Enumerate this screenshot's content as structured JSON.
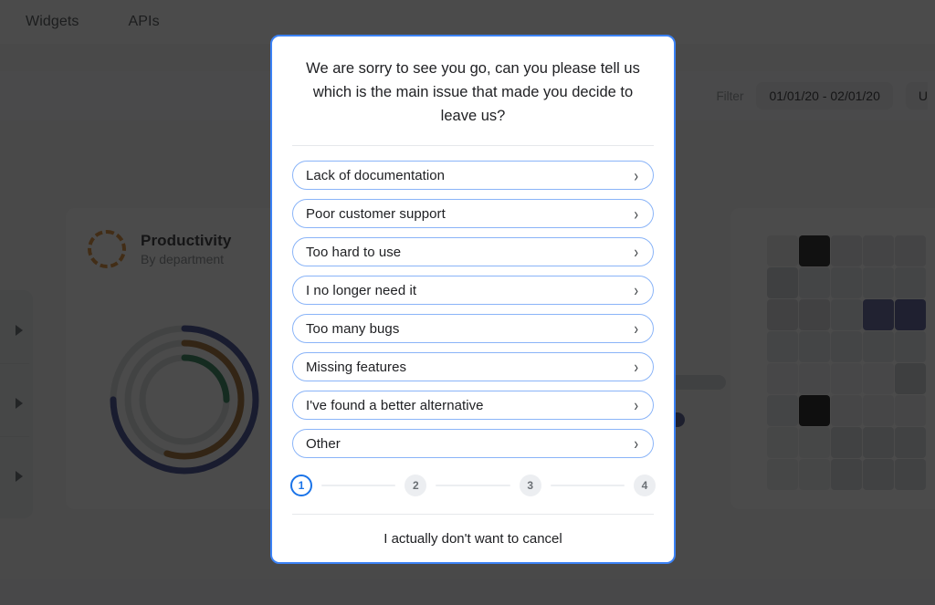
{
  "background": {
    "topnav": {
      "tabs": [
        {
          "label": "Widgets"
        },
        {
          "label": "APIs"
        }
      ]
    },
    "filterbar": {
      "filter_label": "Filter",
      "date_range": "01/01/20 - 02/01/20",
      "next_button_label": "U"
    },
    "productivity_card": {
      "title": "Productivity",
      "subtitle": "By department",
      "icon": "dashed-circle-icon",
      "donut": {
        "rings": [
          {
            "name": "outer",
            "color": "#2f3b8c",
            "percent": 75
          },
          {
            "name": "middle",
            "color": "#9b6120",
            "percent": 55
          },
          {
            "name": "inner",
            "color": "#1d7a4d",
            "percent": 25
          }
        ],
        "track_color": "#d9dbde"
      }
    },
    "heatmap": {
      "rows": [
        [
          "#e8e9eb",
          "#0d0d0d",
          "#dfe1e4",
          "#dfe1e4",
          "#dfe1e4"
        ],
        [
          "#cdd0d4",
          "#e3e5e8",
          "#e3e5e8",
          "#e3e5e8",
          "#e3e5e8"
        ],
        [
          "#d3d6da",
          "#d3d6da",
          "#e3e5e8",
          "#4f5694",
          "#474e8e"
        ],
        [
          "#e3e5e8",
          "#e3e5e8",
          "#e3e5e8",
          "#e3e5e8",
          "#e3e5e8"
        ],
        [
          "#eceef0",
          "#eceef0",
          "#eceef0",
          "#eceef0",
          "#c9ccd1"
        ],
        [
          "#e3e5e8",
          "#080808",
          "#e9ebed",
          "#e9ebed",
          "#e9ebed"
        ],
        [
          "#ebedef",
          "#ebedef",
          "#d4d7db",
          "#d4d7db",
          "#d4d7db"
        ],
        [
          "#ebedef",
          "#ebedef",
          "#d4d7db",
          "#d4d7db",
          "#d4d7db"
        ]
      ]
    },
    "left_rail": {
      "expand_arrows": 3
    },
    "mid_bars": [
      {
        "color": "#cfd3d9"
      },
      {
        "color": "#3f4a86"
      }
    ]
  },
  "modal": {
    "title": "We are sorry to see you go, can you please tell us which is the main issue that made you decide to leave us?",
    "chevron_glyph": "›",
    "accent_color": "#3b82f6",
    "options": [
      {
        "label": "Lack of documentation"
      },
      {
        "label": "Poor customer support"
      },
      {
        "label": "Too hard to use"
      },
      {
        "label": "I no longer need it"
      },
      {
        "label": "Too many bugs"
      },
      {
        "label": "Missing features"
      },
      {
        "label": "I've found a better alternative"
      },
      {
        "label": "Other"
      }
    ],
    "stepper": {
      "steps": [
        {
          "label": "1",
          "active": true
        },
        {
          "label": "2",
          "active": false
        },
        {
          "label": "3",
          "active": false
        },
        {
          "label": "4",
          "active": false
        }
      ]
    },
    "footer": {
      "cancel_link_label": "I actually don't want to cancel"
    }
  }
}
